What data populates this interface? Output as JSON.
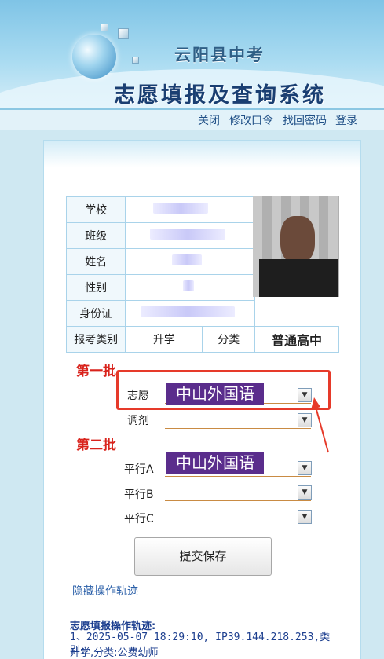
{
  "header": {
    "title_line1": "云阳县中考",
    "title_line2": "志愿填报及查询系统"
  },
  "nav": {
    "close": "关闭",
    "change_password": "修改口令",
    "recover_password": "找回密码",
    "login": "登录"
  },
  "student_info": {
    "school_label": "学校",
    "class_label": "班级",
    "name_label": "姓名",
    "gender_label": "性别",
    "id_label": "身份证",
    "exam_type_label": "报考类别",
    "exam_type_value": "升学",
    "category_label": "分类",
    "category_value": "普通高中"
  },
  "batch1": {
    "title": "第一批",
    "choice_label": "志愿",
    "choice_value": "中山外国语",
    "adjust_label": "调剂",
    "adjust_value": ""
  },
  "batch2": {
    "title": "第二批",
    "parallel_a_label": "平行A",
    "parallel_a_value": "中山外国语",
    "parallel_b_label": "平行B",
    "parallel_b_value": "",
    "parallel_c_label": "平行C",
    "parallel_c_value": ""
  },
  "actions": {
    "submit_label": "提交保存",
    "hide_trail_label": "隐藏操作轨迹"
  },
  "trail": {
    "title": "志愿填报操作轨迹:",
    "entry1_line1": "1、2025-05-07 18:29:10, IP39.144.218.253,类别:",
    "entry1_line2": "升学,分类:公费幼师"
  },
  "colors": {
    "accent_red": "#e63a2a",
    "batch_red": "#d9231c",
    "chip_purple": "#5a2d8c",
    "link_blue": "#2a5fa8"
  }
}
